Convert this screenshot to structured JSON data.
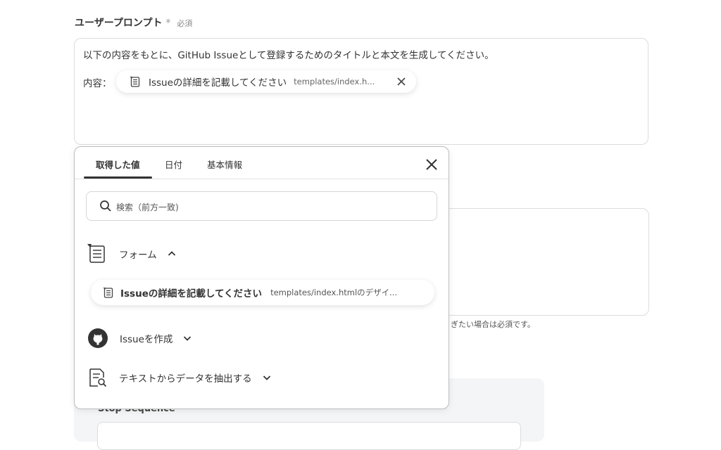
{
  "field": {
    "title": "ユーザープロンプト",
    "star": "*",
    "required": "必須"
  },
  "prompt": {
    "line1": "以下の内容をもとに、GitHub Issueとして登録するためのタイトルと本文を生成してください。",
    "line2_label": "内容：",
    "chip_title": "Issueの詳細を記載してください",
    "chip_source": "templates/index.h..."
  },
  "background": {
    "help_text": "ぎたい場合は必須です。",
    "panel_label": "Stop Sequence"
  },
  "popover": {
    "tabs": [
      {
        "label": "取得した値",
        "active": true
      },
      {
        "label": "日付",
        "active": false
      },
      {
        "label": "基本情報",
        "active": false
      }
    ],
    "search_placeholder": "検索（前方一致)",
    "sections": [
      {
        "label": "フォーム",
        "icon": "form-icon",
        "expanded": true
      },
      {
        "label": "Issueを作成",
        "icon": "github-icon",
        "expanded": false
      },
      {
        "label": "テキストからデータを抽出する",
        "icon": "document-search-icon",
        "expanded": false
      }
    ],
    "form_item": {
      "title": "Issueの詳細を記載してください",
      "source": "templates/index.htmlのデザイ..."
    }
  },
  "colors": {
    "border": "#dcdcdc",
    "text": "#333333",
    "panel_bg": "#f4f5f7"
  }
}
